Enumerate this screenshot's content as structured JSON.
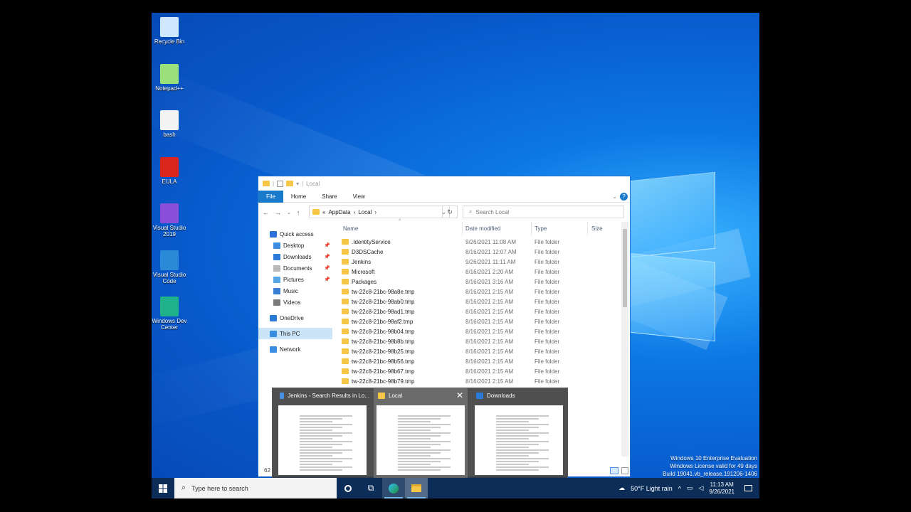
{
  "desktop": {
    "icons": [
      {
        "label": "Recycle Bin",
        "icon": "recycle-bin-icon",
        "color": "#cfe7ff"
      },
      {
        "label": "Notepad++",
        "icon": "notepadpp-icon",
        "color": "#9be07a"
      },
      {
        "label": "bash",
        "icon": "file-icon",
        "color": "#f4f4f4"
      },
      {
        "label": "EULA",
        "icon": "pdf-icon",
        "color": "#d9261c"
      },
      {
        "label": "Visual Studio 2019",
        "icon": "visual-studio-icon",
        "color": "#8a4fd8"
      },
      {
        "label": "Visual Studio Code",
        "icon": "vscode-icon",
        "color": "#2a8ad8"
      },
      {
        "label": "Windows Dev Center",
        "icon": "edge-icon",
        "color": "#1fb08c"
      }
    ],
    "watermark": [
      "Windows 10 Enterprise Evaluation",
      "Windows License valid for 49 days",
      "Build 19041.vb_release.191206-1406"
    ]
  },
  "explorer": {
    "title": "Local",
    "ribbon_tabs": [
      "File",
      "Home",
      "Share",
      "View"
    ],
    "breadcrumb": [
      "AppData",
      "Local"
    ],
    "search_placeholder": "Search Local",
    "nav": [
      {
        "label": "Quick access",
        "icon": "star-icon",
        "color": "#2c6fd6",
        "pinned": false,
        "indent": false
      },
      {
        "label": "Desktop",
        "icon": "desktop-icon",
        "color": "#3a8de0",
        "pinned": true,
        "indent": true
      },
      {
        "label": "Downloads",
        "icon": "downloads-icon",
        "color": "#2b7bd8",
        "pinned": true,
        "indent": true
      },
      {
        "label": "Documents",
        "icon": "documents-icon",
        "color": "#b9b9b9",
        "pinned": true,
        "indent": true
      },
      {
        "label": "Pictures",
        "icon": "pictures-icon",
        "color": "#58a7e6",
        "pinned": true,
        "indent": true
      },
      {
        "label": "Music",
        "icon": "music-icon",
        "color": "#3a7fd6",
        "pinned": false,
        "indent": true
      },
      {
        "label": "Videos",
        "icon": "videos-icon",
        "color": "#7b7b7b",
        "pinned": false,
        "indent": true
      },
      {
        "label": "OneDrive",
        "icon": "onedrive-icon",
        "color": "#2a7ad8",
        "pinned": false,
        "indent": false
      },
      {
        "label": "This PC",
        "icon": "this-pc-icon",
        "color": "#3a8de0",
        "pinned": false,
        "indent": false
      },
      {
        "label": "Network",
        "icon": "network-icon",
        "color": "#3a8de0",
        "pinned": false,
        "indent": false
      }
    ],
    "columns": [
      "Name",
      "Date modified",
      "Type",
      "Size"
    ],
    "rows": [
      {
        "name": ".IdentityService",
        "date": "9/26/2021 11:08 AM",
        "type": "File folder"
      },
      {
        "name": "D3DSCache",
        "date": "8/16/2021 12:07 AM",
        "type": "File folder"
      },
      {
        "name": "Jenkins",
        "date": "9/26/2021 11:11 AM",
        "type": "File folder"
      },
      {
        "name": "Microsoft",
        "date": "8/16/2021 2:20 AM",
        "type": "File folder"
      },
      {
        "name": "Packages",
        "date": "8/16/2021 3:16 AM",
        "type": "File folder"
      },
      {
        "name": "tw-22c8-21bc-98a8e.tmp",
        "date": "8/16/2021 2:15 AM",
        "type": "File folder"
      },
      {
        "name": "tw-22c8-21bc-98ab0.tmp",
        "date": "8/16/2021 2:15 AM",
        "type": "File folder"
      },
      {
        "name": "tw-22c8-21bc-98ad1.tmp",
        "date": "8/16/2021 2:15 AM",
        "type": "File folder"
      },
      {
        "name": "tw-22c8-21bc-98af2.tmp",
        "date": "8/16/2021 2:15 AM",
        "type": "File folder"
      },
      {
        "name": "tw-22c8-21bc-98b04.tmp",
        "date": "8/16/2021 2:15 AM",
        "type": "File folder"
      },
      {
        "name": "tw-22c8-21bc-98b8b.tmp",
        "date": "8/16/2021 2:15 AM",
        "type": "File folder"
      },
      {
        "name": "tw-22c8-21bc-98b25.tmp",
        "date": "8/16/2021 2:15 AM",
        "type": "File folder"
      },
      {
        "name": "tw-22c8-21bc-98b56.tmp",
        "date": "8/16/2021 2:15 AM",
        "type": "File folder"
      },
      {
        "name": "tw-22c8-21bc-98b67.tmp",
        "date": "8/16/2021 2:15 AM",
        "type": "File folder"
      },
      {
        "name": "tw-22c8-21bc-98b79.tmp",
        "date": "8/16/2021 2:15 AM",
        "type": "File folder"
      }
    ],
    "status_count": "62"
  },
  "thumbnails": [
    {
      "title": "Jenkins - Search Results in Lo...",
      "icon": "search-folder-icon",
      "color": "#4a90e2"
    },
    {
      "title": "Local",
      "icon": "folder-icon",
      "color": "#f6c747"
    },
    {
      "title": "Downloads",
      "icon": "downloads-icon",
      "color": "#2b7bd8"
    }
  ],
  "taskbar": {
    "search_placeholder": "Type here to search",
    "weather": "50°F  Light rain",
    "time": "11:13 AM",
    "date": "9/26/2021"
  }
}
